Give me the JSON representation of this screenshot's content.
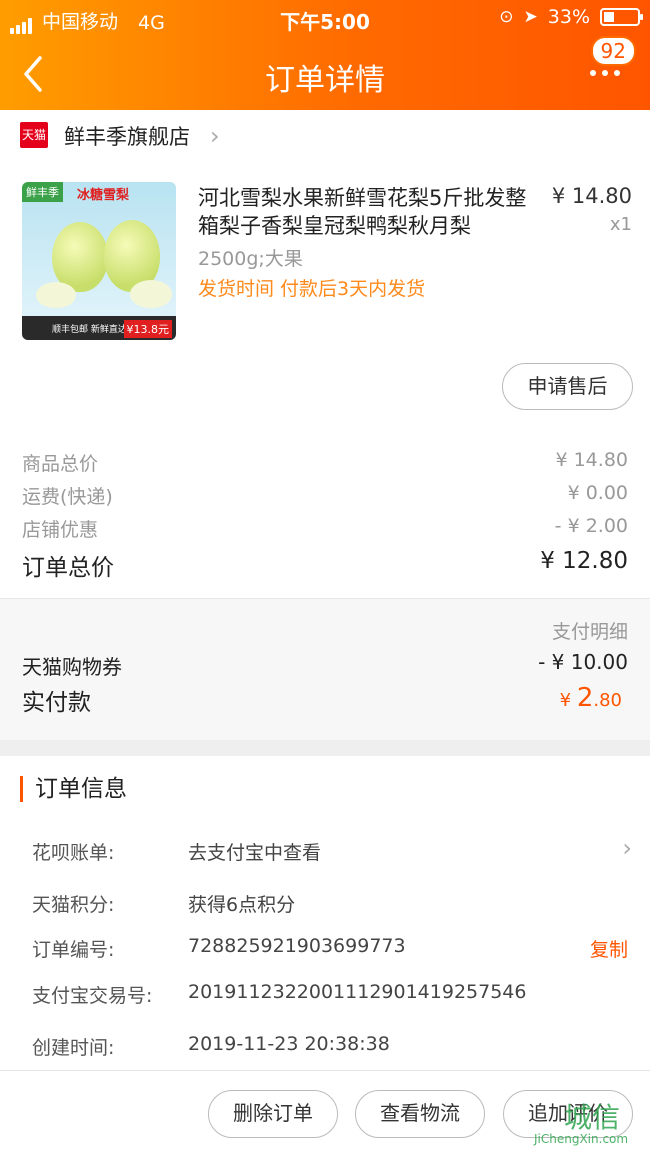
{
  "status_bar": {
    "carrier": "中国移动",
    "network": "4G",
    "time": "下午5:00",
    "battery": "33%"
  },
  "nav": {
    "title": "订单详情",
    "badge": "92"
  },
  "shop": {
    "name": "鲜丰季旗舰店",
    "brand_tag": "天猫"
  },
  "product": {
    "title": "河北雪梨水果新鲜雪花梨5斤批发整箱梨子香梨皇冠梨鸭梨秋月梨",
    "price": "¥ 14.80",
    "qty": "x1",
    "sku": "2500g;大果",
    "shipping": "发货时间  付款后3天内发货",
    "thumb": {
      "tag": "鲜丰季",
      "title": "冰糖雪梨",
      "bottom": "顺丰包邮 新鲜直达 5斤",
      "price": "¥13.8元"
    },
    "after_sale_label": "申请售后"
  },
  "summary": [
    {
      "label": "商品总价",
      "value": "¥ 14.80"
    },
    {
      "label": "运费(快递)",
      "value": "¥ 0.00"
    },
    {
      "label": "店铺优惠",
      "value": "- ¥ 2.00"
    }
  ],
  "order_total": {
    "label": "订单总价",
    "value": "¥ 12.80"
  },
  "payment": {
    "detail_label": "支付明细",
    "coupon_label": "天猫购物券",
    "coupon_value": "- ¥ 10.00",
    "paid_label": "实付款",
    "paid_currency": "¥",
    "paid_int": "2",
    "paid_dec": ".80"
  },
  "info": {
    "heading": "订单信息",
    "rows": [
      {
        "key": "花呗账单:",
        "value": "去支付宝中查看"
      },
      {
        "key": "天猫积分:",
        "value": "获得6点积分"
      },
      {
        "key": "订单编号:",
        "value": "728825921903699773",
        "action": "复制"
      },
      {
        "key": "支付宝交易号:",
        "value": "2019112322001112901419257546"
      },
      {
        "key": "创建时间:",
        "value": "2019-11-23 20:38:38"
      }
    ]
  },
  "footer": {
    "delete": "删除订单",
    "logistics": "查看物流",
    "review": "追加评价"
  },
  "watermark": {
    "text": "城信",
    "site": "JiChengXin.com"
  },
  "colors": {
    "accent": "#ff5500",
    "header_start": "#ff9d00",
    "ship": "#ff8a1c"
  }
}
